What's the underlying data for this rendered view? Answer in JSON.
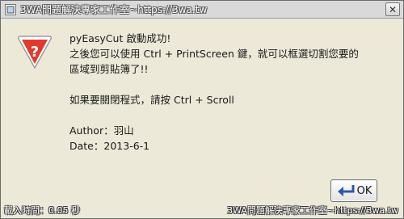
{
  "window": {
    "title": "3WA問題解決專家工作室~https://3wa.tw"
  },
  "message": {
    "lines": [
      "pyEasyCut 啟動成功!",
      "之後您可以使用 Ctrl + PrintScreen 鍵，就可以框選切割您要的",
      "區域到剪貼簿了!!",
      "如果要關閉程式，請按 Ctrl + Scroll",
      "Author：羽山",
      "Date：2013-6-1"
    ]
  },
  "buttons": {
    "ok_label": "OK",
    "close_symbol": "✕"
  },
  "status": {
    "load_time": "載入時間：0.05 秒",
    "watermark": "3WA問題解決專家工作室~https://3wa.tw"
  },
  "colors": {
    "warning_red": "#e23b2e",
    "dialog_bg": "#ece9d8"
  }
}
